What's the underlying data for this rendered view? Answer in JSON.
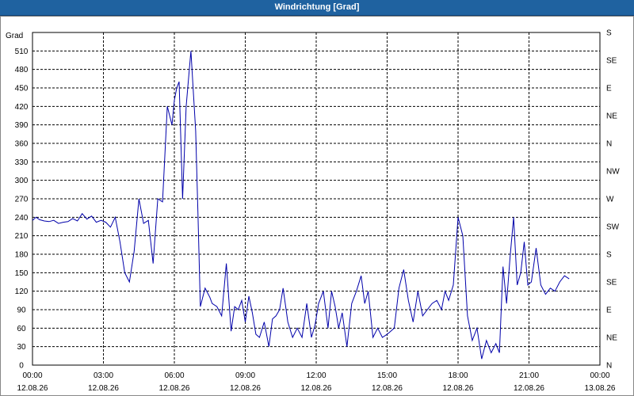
{
  "window": {
    "title": "Windrichtung [Grad]"
  },
  "colors": {
    "titlebar": "#1f62a0",
    "line": "#0000aa",
    "grid": "#000000"
  },
  "chart_data": {
    "type": "line",
    "title": "Windrichtung [Grad]",
    "ylabel": "Grad",
    "ylim": [
      0,
      540
    ],
    "xlim": [
      "12.08.26 00:00",
      "13.08.26 00:00"
    ],
    "grid": true,
    "y_ticks": [
      "0",
      "30",
      "60",
      "90",
      "120",
      "150",
      "180",
      "210",
      "240",
      "270",
      "300",
      "330",
      "360",
      "390",
      "420",
      "450",
      "480",
      "510"
    ],
    "y_right_ticks": [
      "N",
      "NE",
      "E",
      "SE",
      "S",
      "SW",
      "W",
      "NW",
      "N",
      "NE",
      "E",
      "SE",
      "S"
    ],
    "x_ticks": [
      {
        "time": "00:00",
        "date": "12.08.26"
      },
      {
        "time": "03:00",
        "date": "12.08.26"
      },
      {
        "time": "06:00",
        "date": "12.08.26"
      },
      {
        "time": "09:00",
        "date": "12.08.26"
      },
      {
        "time": "12:00",
        "date": "12.08.26"
      },
      {
        "time": "15:00",
        "date": "12.08.26"
      },
      {
        "time": "18:00",
        "date": "12.08.26"
      },
      {
        "time": "21:00",
        "date": "12.08.26"
      },
      {
        "time": "00:00",
        "date": "13.08.26"
      }
    ],
    "series": [
      {
        "x_hours": [
          0,
          0.15,
          0.3,
          0.5,
          0.7,
          0.9,
          1.1,
          1.3,
          1.5,
          1.7,
          1.9,
          2.1,
          2.3,
          2.5,
          2.7,
          2.9,
          3.1,
          3.3,
          3.5,
          3.7,
          3.9,
          4.1,
          4.3,
          4.5,
          4.7,
          4.9,
          5.1,
          5.3,
          5.5,
          5.7,
          5.9,
          6.0,
          6.1,
          6.2,
          6.35,
          6.5,
          6.7,
          6.9,
          7.0,
          7.1,
          7.3,
          7.5,
          7.6,
          7.8,
          8.0,
          8.2,
          8.4,
          8.55,
          8.7,
          8.85,
          9.0,
          9.15,
          9.3,
          9.45,
          9.6,
          9.8,
          10.0,
          10.15,
          10.3,
          10.45,
          10.6,
          10.8,
          11.0,
          11.2,
          11.4,
          11.6,
          11.8,
          11.95,
          12.1,
          12.3,
          12.5,
          12.65,
          12.8,
          12.95,
          13.1,
          13.3,
          13.5,
          13.7,
          13.9,
          14.05,
          14.2,
          14.4,
          14.6,
          14.8,
          15.0,
          15.15,
          15.3,
          15.5,
          15.7,
          15.9,
          16.1,
          16.3,
          16.5,
          16.7,
          16.9,
          17.1,
          17.3,
          17.45,
          17.6,
          17.8,
          18.0,
          18.2,
          18.4,
          18.6,
          18.8,
          19.0,
          19.2,
          19.4,
          19.6,
          19.75,
          19.9,
          20.05,
          20.2,
          20.35,
          20.5,
          20.65,
          20.8,
          20.95,
          21.1,
          21.3,
          21.5,
          21.7,
          21.9,
          22.1,
          22.3,
          22.5,
          22.7,
          22.9,
          23.1,
          23.3,
          23.5,
          23.7,
          23.85,
          24.0
        ],
        "values": [
          235,
          240,
          236,
          234,
          233,
          235,
          230,
          232,
          233,
          238,
          234,
          246,
          237,
          242,
          232,
          235,
          232,
          224,
          240,
          200,
          150,
          135,
          185,
          270,
          230,
          235,
          165,
          270,
          265,
          420,
          390,
          430,
          450,
          460,
          270,
          420,
          510,
          380,
          245,
          95,
          125,
          110,
          100,
          95,
          80,
          165,
          55,
          95,
          90,
          105,
          70,
          112,
          85,
          50,
          45,
          70,
          30,
          75,
          80,
          90,
          125,
          70,
          45,
          60,
          45,
          100,
          45,
          65,
          100,
          120,
          60,
          120,
          95,
          60,
          85,
          30,
          100,
          120,
          145,
          100,
          120,
          45,
          60,
          45,
          50,
          55,
          60,
          125,
          155,
          105,
          70,
          120,
          80,
          90,
          100,
          105,
          90,
          120,
          105,
          130,
          240,
          210,
          80,
          40,
          60,
          10,
          40,
          20,
          35,
          20,
          160,
          100,
          175,
          240,
          130,
          150,
          200,
          130,
          135,
          190,
          130,
          115,
          125,
          120,
          135,
          145,
          140
        ]
      }
    ]
  }
}
